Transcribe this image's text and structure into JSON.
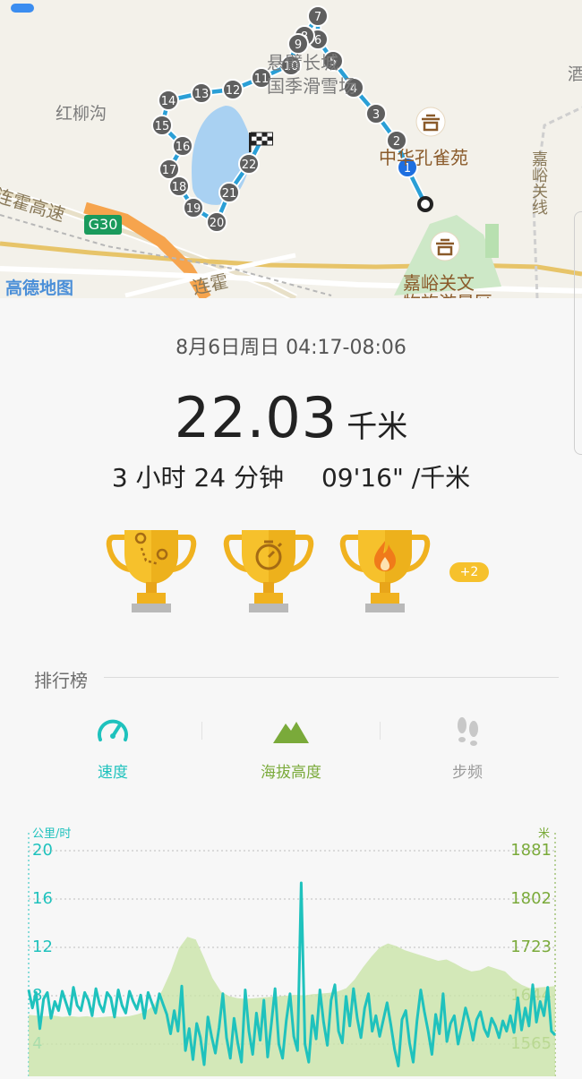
{
  "map": {
    "place_labels": [
      "红柳沟",
      "悬臂长城",
      "国季滑雪场",
      "中华孔雀苑",
      "嘉峪关文",
      "物旅游景区",
      "嘉峪关线",
      "酒"
    ],
    "road_labels": [
      "连霍高速",
      "连霍"
    ],
    "highway_shield": "G30",
    "logo": "高德地图",
    "markers": [
      "1",
      "2",
      "3",
      "4",
      "5",
      "6",
      "7",
      "8",
      "9",
      "10",
      "11",
      "12",
      "13",
      "14",
      "15",
      "16",
      "17",
      "18",
      "19",
      "20",
      "21",
      "22"
    ],
    "route_color": "#2a9fd6",
    "start_marker_color": "#1e6fe0"
  },
  "workout": {
    "date": "8月6日周日 04:17-08:06",
    "distance": "22.03",
    "distance_unit": "千米",
    "duration": "3 小时 24 分钟",
    "pace": "09'16\" /千米"
  },
  "achievements": {
    "trophies": [
      "route-trophy-icon",
      "stopwatch-trophy-icon",
      "flame-trophy-icon"
    ],
    "more_badge": "+2"
  },
  "ranking": {
    "title": "排行榜",
    "tabs": [
      {
        "label": "速度",
        "icon": "speedometer-icon",
        "color": "#1fc2bd"
      },
      {
        "label": "海拔高度",
        "icon": "mountain-icon",
        "color": "#7aaa3a"
      },
      {
        "label": "步频",
        "icon": "footsteps-icon",
        "color": "#9a9a9a"
      }
    ]
  },
  "chart_data": {
    "type": "line",
    "left_axis_unit": "公里/时",
    "right_axis_unit": "米",
    "left_ticks": [
      "20",
      "16",
      "12",
      "8",
      "4"
    ],
    "right_ticks": [
      "1881",
      "1802",
      "1723",
      "1644",
      "1565"
    ],
    "ylim_left": [
      2.5,
      20
    ],
    "ylim_right": [
      1543,
      1881
    ],
    "grid": true,
    "series": [
      {
        "name": "速度",
        "color": "#1fc2bd",
        "values": [
          9.2,
          7.8,
          9.0,
          6.2,
          8.5,
          9.0,
          7.0,
          8.3,
          7.6,
          9.1,
          8.2,
          7.3,
          9.4,
          8.0,
          7.6,
          9.0,
          8.4,
          7.2,
          9.3,
          8.1,
          7.5,
          9.0,
          8.6,
          7.1,
          9.2,
          8.0,
          7.4,
          9.1,
          8.3,
          7.7,
          8.8,
          7.0,
          9.0,
          8.2,
          7.4,
          8.9,
          8.1,
          7.3,
          5.8,
          7.6,
          6.0,
          9.5,
          4.5,
          6.2,
          3.8,
          6.6,
          5.5,
          3.4,
          7.1,
          5.6,
          4.3,
          6.3,
          8.9,
          5.5,
          3.9,
          7.0,
          5.1,
          3.6,
          9.2,
          6.0,
          4.2,
          7.4,
          5.3,
          8.4,
          4.0,
          6.6,
          9.3,
          5.0,
          3.9,
          6.8,
          8.9,
          5.6,
          4.5,
          17.5,
          5.0,
          3.6,
          7.2,
          5.4,
          9.2,
          6.7,
          4.9,
          8.4,
          9.6,
          6.0,
          5.1,
          8.7,
          6.4,
          9.3,
          7.0,
          5.5,
          7.8,
          8.9,
          6.0,
          7.2,
          5.6,
          6.9,
          8.2,
          6.5,
          4.6,
          3.3,
          6.9,
          7.6,
          5.1,
          3.6,
          6.8,
          9.2,
          7.5,
          6.0,
          4.2,
          7.3,
          5.8,
          8.9,
          5.2,
          6.6,
          7.2,
          5.0,
          6.3,
          7.8,
          6.7,
          5.3,
          6.9,
          7.5,
          6.2,
          5.6,
          7.0,
          6.4,
          5.5,
          6.8,
          6.0,
          7.2,
          5.9,
          8.6,
          6.1,
          7.8,
          6.4,
          9.6,
          6.7,
          8.3,
          7.2,
          9.4,
          6.0,
          5.7
        ]
      },
      {
        "name": "海拔高度",
        "color": "#c9e3a8",
        "values": [
          1635,
          1634,
          1633,
          1634,
          1632,
          1633,
          1632,
          1633,
          1631,
          1632,
          1633,
          1632,
          1633,
          1636,
          1640,
          1650,
          1672,
          1700,
          1735,
          1752,
          1748,
          1720,
          1690,
          1670,
          1663,
          1660,
          1659,
          1660,
          1661,
          1662,
          1663,
          1664,
          1665,
          1664,
          1666,
          1667,
          1668,
          1670,
          1675,
          1688,
          1706,
          1722,
          1736,
          1742,
          1738,
          1732,
          1728,
          1724,
          1720,
          1716,
          1718,
          1712,
          1705,
          1700,
          1702,
          1708,
          1704,
          1700,
          1688,
          1680,
          1675,
          1676,
          1677,
          1678
        ]
      }
    ]
  }
}
